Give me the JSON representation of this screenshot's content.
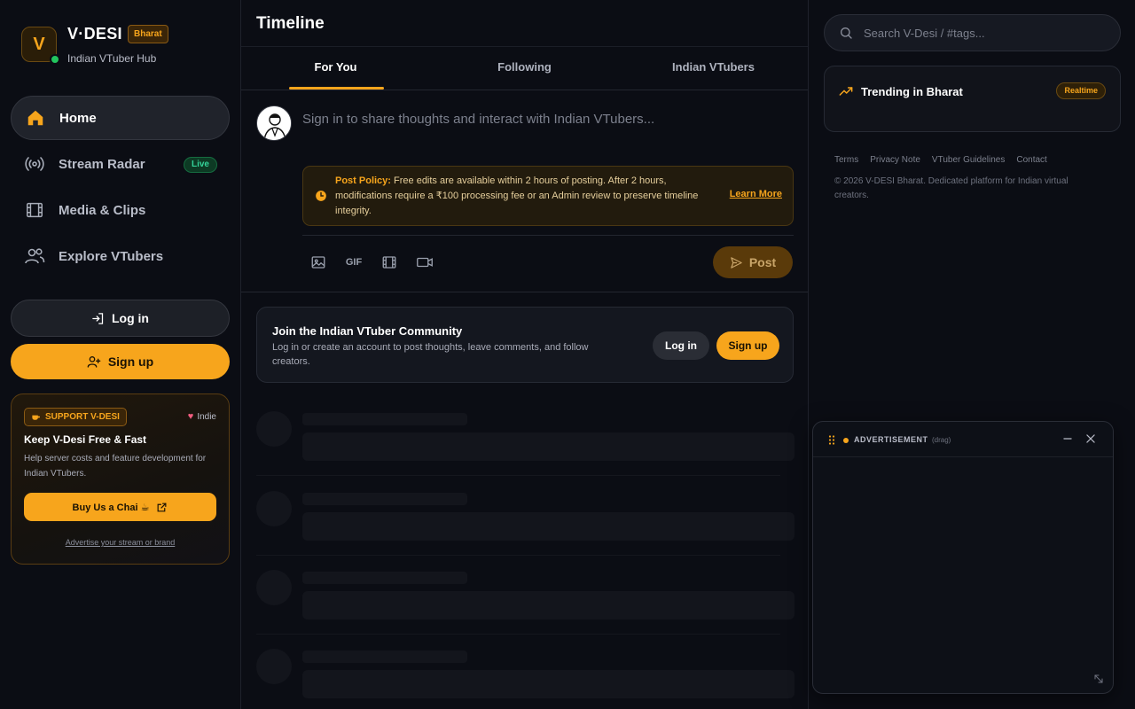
{
  "brand": {
    "logo_letter": "V",
    "name": "V·DESI",
    "badge": "Bharat",
    "subtitle": "Indian VTuber Hub"
  },
  "nav": {
    "items": [
      {
        "label": "Home",
        "icon": "home-icon",
        "active": true
      },
      {
        "label": "Stream Radar",
        "icon": "radar-icon",
        "badge": "Live"
      },
      {
        "label": "Media & Clips",
        "icon": "film-icon"
      },
      {
        "label": "Explore VTubers",
        "icon": "users-icon"
      }
    ]
  },
  "auth": {
    "login_label": "Log in",
    "signup_label": "Sign up"
  },
  "support": {
    "tag": "SUPPORT V-DESI",
    "indie": "Indie",
    "title": "Keep V-Desi Free & Fast",
    "description": "Help server costs and feature development for Indian VTubers.",
    "button": "Buy Us a Chai ☕",
    "advertise": "Advertise your stream or brand"
  },
  "main": {
    "title": "Timeline",
    "tabs": [
      {
        "label": "For You",
        "active": true
      },
      {
        "label": "Following"
      },
      {
        "label": "Indian VTubers"
      }
    ],
    "composer": {
      "placeholder": "Sign in to share thoughts and interact with Indian VTubers...",
      "policy_label": "Post Policy:",
      "policy_text": " Free edits are available within 2 hours of posting. After 2 hours, modifications require a ₹100 processing fee or an Admin review to preserve timeline integrity.",
      "learn_more": "Learn More",
      "gif_label": "GIF",
      "post_label": "Post"
    },
    "join": {
      "title": "Join the Indian VTuber Community",
      "description": "Log in or create an account to post thoughts, leave comments, and follow creators.",
      "login": "Log in",
      "signup": "Sign up"
    }
  },
  "right": {
    "search_placeholder": "Search V-Desi / #tags...",
    "trending_title": "Trending in Bharat",
    "trending_badge": "Realtime",
    "footer_links": [
      "Terms",
      "Privacy Note",
      "VTuber Guidelines",
      "Contact"
    ],
    "copyright": "© 2026 V-DESI Bharat. Dedicated platform for Indian virtual creators."
  },
  "ad": {
    "label": "ADVERTISEMENT",
    "hint": "(drag)"
  },
  "colors": {
    "accent": "#f7a51c",
    "background": "#0b0d14",
    "live": "#34d399"
  }
}
